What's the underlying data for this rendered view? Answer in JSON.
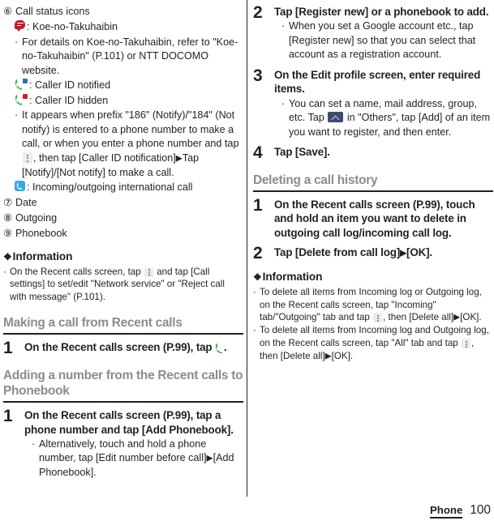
{
  "document": {
    "footer": {
      "chapter": "Phone",
      "page": "100"
    },
    "colors": {
      "text": "#231f20",
      "section_heading": "#8a8c8e",
      "rule": "#231f20",
      "icon_green": "#3ab54a",
      "icon_red": "#c2172b",
      "icon_blue": "#3aa7e0",
      "icon_navy": "#3d4b72",
      "badge_blue": "#2e6fb7",
      "badge_red": "#d0202e"
    }
  },
  "left_column": {
    "legend_items": [
      {
        "marker": "⑥",
        "label": "Call status icons"
      }
    ],
    "icon_descriptions": [
      {
        "icon": "speech-bubble-icon",
        "label": ": Koe-no-Takuhaibin"
      },
      {
        "icon": "caller-id-notified-icon",
        "label": ": Caller ID notified"
      },
      {
        "icon": "caller-id-hidden-icon",
        "label": ": Caller ID hidden"
      },
      {
        "icon": "international-call-icon",
        "label": ": Incoming/outgoing international call"
      }
    ],
    "bullets": {
      "koe_detail": "For details on Koe-no-Takuhaibin, refer to \"Koe-no-Takuhaibin\" (P.101) or NTT DOCOMO website.",
      "prefix_note_part1": "It appears when prefix \"186\" (Notify)/\"184\" (Not notify) is entered to a phone number to make a call, or when you enter a phone number and tap",
      "prefix_note_part2": ", then tap [Caller ID notification]",
      "prefix_note_part3": "Tap [Notify]/[Not notify] to make a call."
    },
    "numbered_legend": [
      {
        "marker": "⑦",
        "label": "Date"
      },
      {
        "marker": "⑧",
        "label": "Outgoing"
      },
      {
        "marker": "⑨",
        "label": "Phonebook"
      }
    ],
    "information": {
      "heading": "Information",
      "diamond": "❖",
      "bullets": [
        {
          "part1": "On the Recent calls screen, tap",
          "icon": "overflow-menu-icon",
          "part2": "and tap [Call settings] to set/edit \"Network service\" or \"Reject call with message\" (P.101)."
        }
      ]
    },
    "sections": [
      {
        "title": "Making a call from Recent calls",
        "steps": [
          {
            "number": "1",
            "title_part1": "On the Recent calls screen (P.99), tap",
            "icon": "phone-handset-icon",
            "title_part2": "."
          }
        ]
      },
      {
        "title": "Adding a number from the Recent calls to Phonebook",
        "steps": [
          {
            "number": "1",
            "title": "On the Recent calls screen (P.99), tap a phone number and tap [Add Phonebook].",
            "notes": [
              {
                "part1": "Alternatively, touch and hold a phone number, tap [Edit number before call]",
                "arrow": "▶",
                "part2": "[Add Phonebook]."
              }
            ]
          }
        ]
      }
    ]
  },
  "right_column": {
    "steps_continued": [
      {
        "number": "2",
        "title": "Tap [Register new] or a phonebook to add.",
        "notes": [
          {
            "text": "When you set a Google account etc., tap [Register new] so that you can select that account as a registration account."
          }
        ]
      },
      {
        "number": "3",
        "title": "On the Edit profile screen, enter required items.",
        "notes": [
          {
            "part1": "You can set a name, mail address, group, etc. Tap",
            "icon": "chevron-up-icon",
            "part2": "in \"Others\", tap [Add] of an item you want to register, and then enter."
          }
        ]
      },
      {
        "number": "4",
        "title": "Tap [Save]."
      }
    ],
    "sections": [
      {
        "title": "Deleting a call history",
        "steps": [
          {
            "number": "1",
            "title": "On the Recent calls screen (P.99), touch and hold an item you want to delete in outgoing call log/incoming call log."
          },
          {
            "number": "2",
            "title_part1": "Tap [Delete from call log]",
            "arrow": "▶",
            "title_part2": "[OK]."
          }
        ]
      }
    ],
    "information": {
      "heading": "Information",
      "diamond": "❖",
      "bullets": [
        {
          "part1": "To delete all items from Incoming log or Outgoing log, on the Recent calls screen, tap \"Incoming\" tab/\"Outgoing\" tab and tap",
          "icon": "overflow-menu-icon",
          "part2": ", then [Delete all]",
          "arrow": "▶",
          "part3": "[OK]."
        },
        {
          "part1": "To delete all items from Incoming log and Outgoing log, on the Recent calls screen, tap \"All\" tab and tap",
          "icon": "overflow-menu-icon",
          "part2": ", then [Delete all]",
          "arrow": "▶",
          "part3": "[OK]."
        }
      ]
    }
  }
}
